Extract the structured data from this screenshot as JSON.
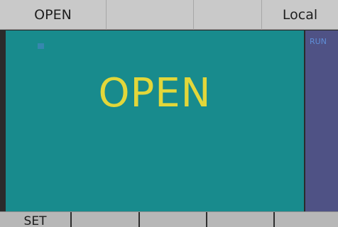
{
  "status_bar": {
    "mode": "OPEN",
    "cell2": "",
    "cell3": "",
    "control": "Local"
  },
  "main": {
    "status_text": "OPEN",
    "marker_color": "#3f86b8",
    "background_color": "#188b8d",
    "text_color": "#e2d73a"
  },
  "side_panel": {
    "run_label": "RUN",
    "background_color": "#4f5285",
    "label_color": "#5f8fd8"
  },
  "softkeys": [
    {
      "label": "SET"
    },
    {
      "label": ""
    },
    {
      "label": ""
    },
    {
      "label": ""
    },
    {
      "label": ""
    }
  ]
}
